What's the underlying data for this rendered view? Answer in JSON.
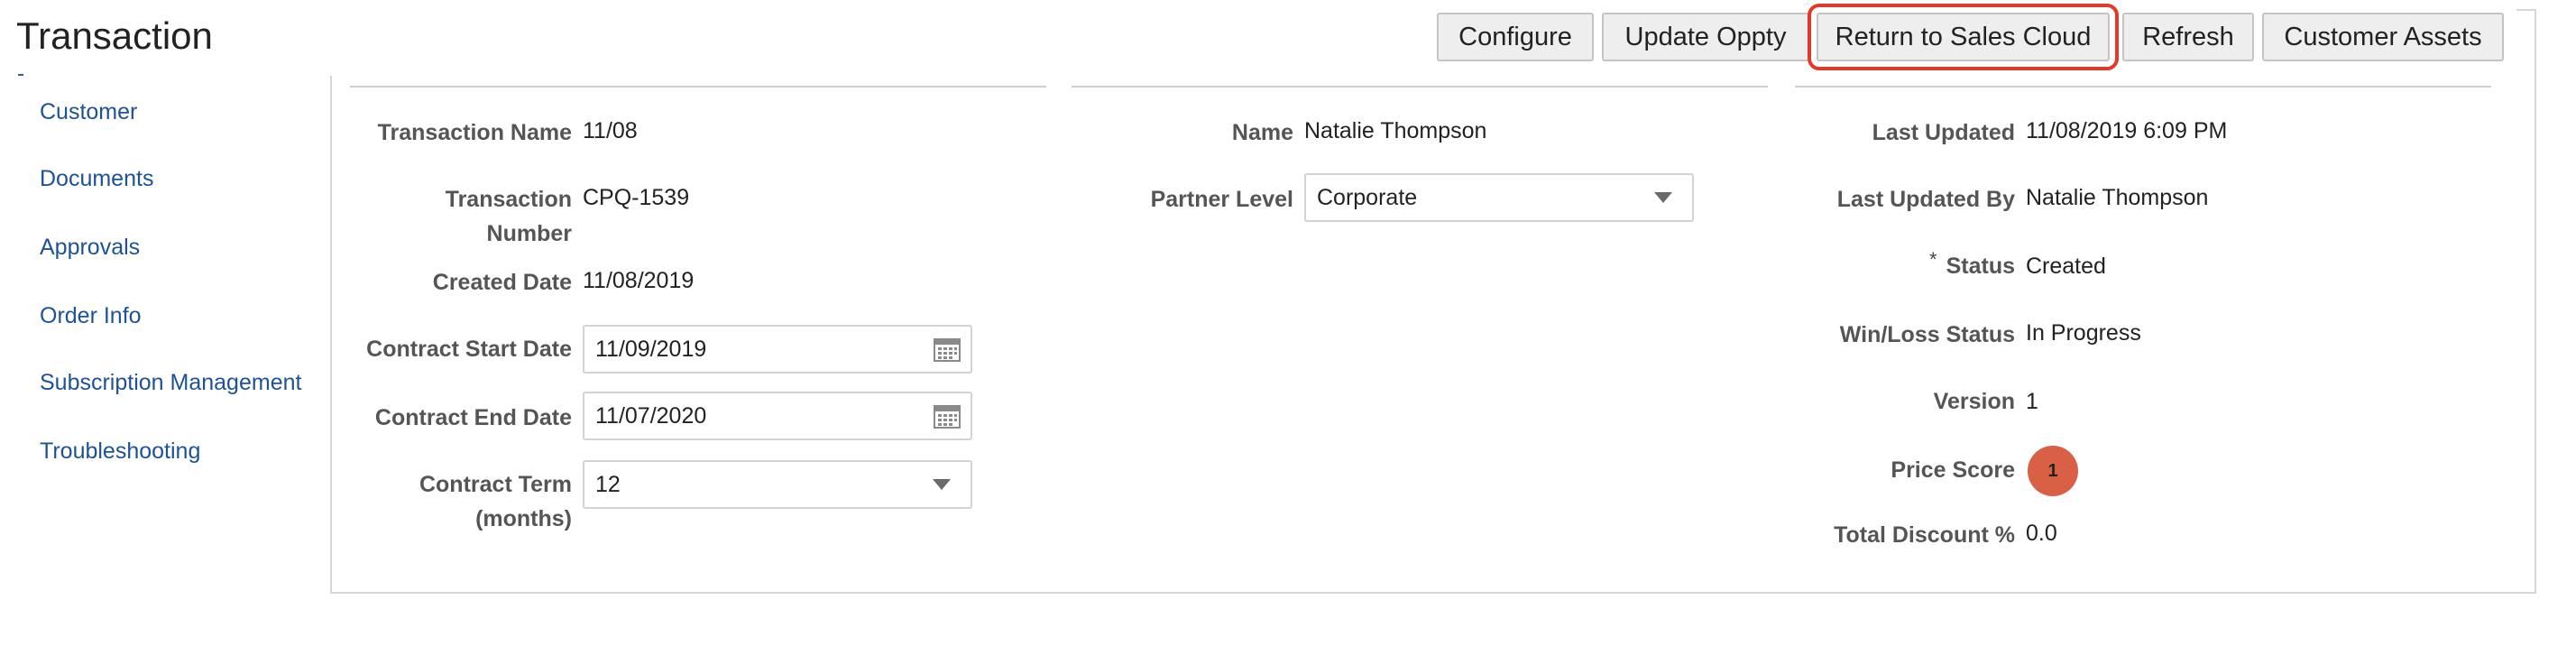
{
  "page": {
    "title": "Transaction"
  },
  "toolbar": {
    "configure": "Configure",
    "update_oppty": "Update Oppty",
    "return_sales_cloud": "Return to Sales Cloud",
    "refresh": "Refresh",
    "customer_assets": "Customer Assets"
  },
  "sidebar": {
    "items": [
      {
        "label": "Customer"
      },
      {
        "label": "Documents"
      },
      {
        "label": "Approvals"
      },
      {
        "label": "Order Info"
      },
      {
        "label": "Subscription Management"
      },
      {
        "label": "Troubleshooting"
      }
    ]
  },
  "col1": {
    "transaction_name_label": "Transaction Name",
    "transaction_name": "11/08",
    "transaction_number_label": "Transaction Number",
    "transaction_number": "CPQ-1539",
    "created_date_label": "Created Date",
    "created_date": "11/08/2019",
    "contract_start_label": "Contract Start Date",
    "contract_start": "11/09/2019",
    "contract_end_label": "Contract End Date",
    "contract_end": "11/07/2020",
    "contract_term_label": "Contract Term (months)",
    "contract_term": "12"
  },
  "col2": {
    "name_label": "Name",
    "name": "Natalie Thompson",
    "partner_level_label": "Partner Level",
    "partner_level": "Corporate"
  },
  "col3": {
    "last_updated_label": "Last Updated",
    "last_updated": "11/08/2019 6:09 PM",
    "last_updated_by_label": "Last Updated By",
    "last_updated_by": "Natalie Thompson",
    "status_required": "*",
    "status_label": "Status",
    "status": "Created",
    "win_loss_label": "Win/Loss Status",
    "win_loss": "In Progress",
    "version_label": "Version",
    "version": "1",
    "price_score_label": "Price Score",
    "price_score": "1",
    "total_discount_label": "Total Discount %",
    "total_discount": "0.0"
  },
  "colors": {
    "link": "#1d5296",
    "highlight": "#e03a2a",
    "score": "#d95f45"
  }
}
